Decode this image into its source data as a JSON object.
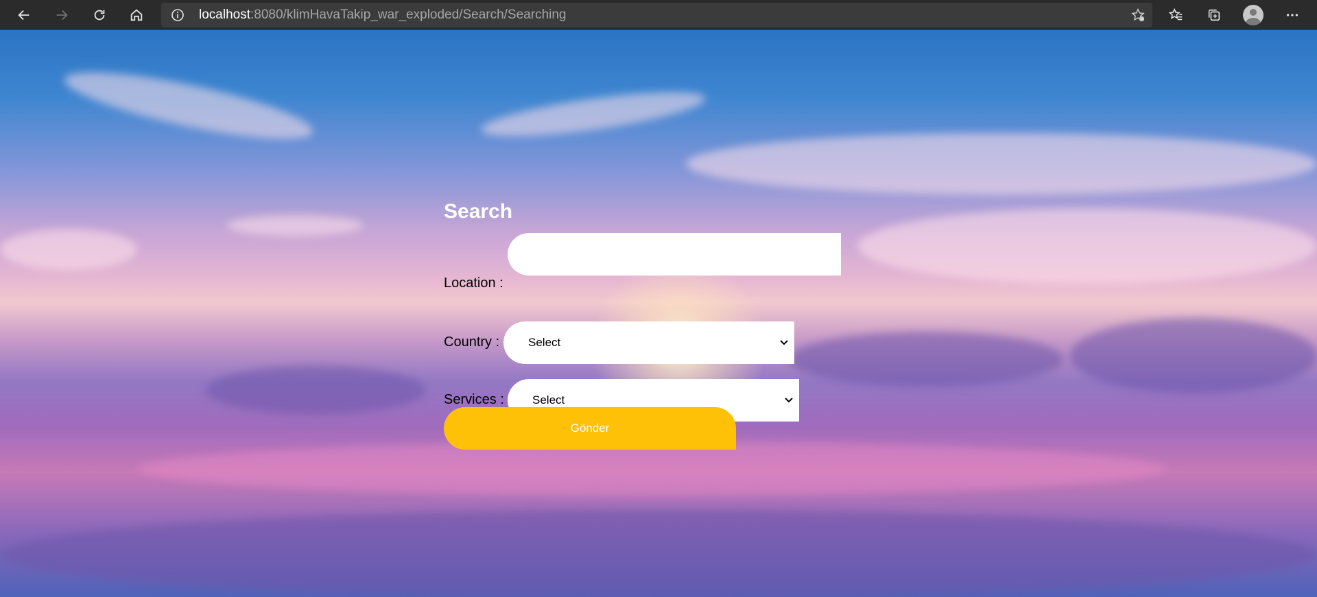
{
  "browser": {
    "url_host": "localhost",
    "url_rest": ":8080/klimHavaTakip_war_exploded/Search/Searching",
    "icons": [
      "back-icon",
      "forward-icon",
      "refresh-icon",
      "home-icon",
      "info-icon",
      "favorite-add-icon",
      "favorites-icon",
      "collections-icon",
      "profile-avatar",
      "more-icon"
    ]
  },
  "form": {
    "title": "Search",
    "location_label": "Location :",
    "location_value": "",
    "country_label": "Country :",
    "country_selected": "Select",
    "services_label": "Services :",
    "services_selected": "Select",
    "submit_label": "Gönder"
  },
  "colors": {
    "button": "#ffc107",
    "title": "#ffffff",
    "browser_chrome": "#2b2b2b"
  }
}
